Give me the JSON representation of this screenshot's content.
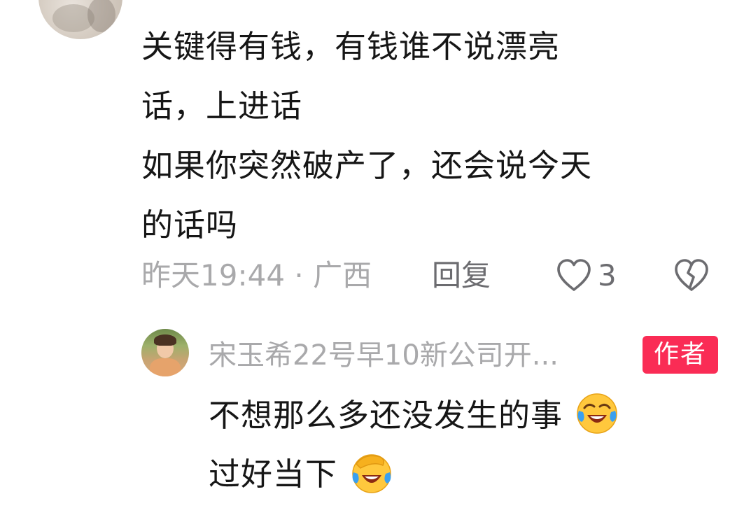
{
  "comment": {
    "text": "关键得有钱，有钱谁不说漂亮\n话，上进话\n如果你突然破产了，还会说今天\n的话吗",
    "time_location": "昨天19:44 · 广西",
    "reply_label": "回复",
    "like_count": "3"
  },
  "reply": {
    "username": "宋玉希22号早10新公司开...",
    "author_badge": "作者",
    "line1": "不想那么多还没发生的事",
    "line2": "过好当下"
  },
  "colors": {
    "badge_bg": "#fa2c55",
    "meta_text": "#a9a9ab",
    "body_text": "#161616"
  },
  "icons": [
    "heart-icon",
    "broken-heart-icon",
    "laughing-crying-emoji"
  ]
}
